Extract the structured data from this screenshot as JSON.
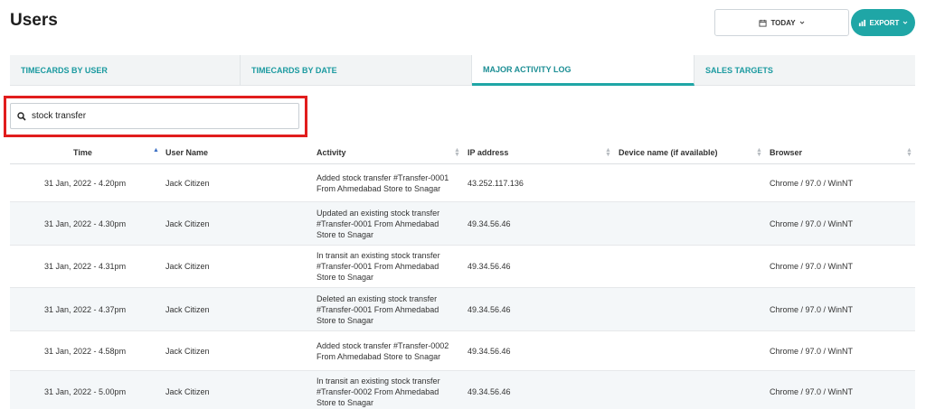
{
  "page": {
    "title": "Users"
  },
  "toolbar": {
    "today_label": "TODAY",
    "export_label": "EXPORT",
    "calendar_icon": "calendar-icon",
    "chart_icon": "bar-chart-icon"
  },
  "tabs": [
    {
      "label": "TIMECARDS BY USER",
      "active": false
    },
    {
      "label": "TIMECARDS BY DATE",
      "active": false
    },
    {
      "label": "MAJOR ACTIVITY LOG",
      "active": true
    },
    {
      "label": "SALES TARGETS",
      "active": false
    }
  ],
  "search": {
    "value": "stock transfer",
    "placeholder": ""
  },
  "table": {
    "columns": [
      "Time",
      "User Name",
      "Activity",
      "IP address",
      "Device name (if available)",
      "Browser"
    ],
    "rows": [
      {
        "time": "31 Jan, 2022 - 4.20pm",
        "user": "Jack Citizen",
        "activity": [
          "Added stock transfer #Transfer-0001",
          "From Ahmedabad Store to Snagar"
        ],
        "ip": "43.252.117.136",
        "device": "",
        "browser": "Chrome / 97.0 / WinNT"
      },
      {
        "time": "31 Jan, 2022 - 4.30pm",
        "user": "Jack Citizen",
        "activity": [
          "Updated an existing stock transfer",
          "#Transfer-0001 From Ahmedabad",
          "Store to Snagar"
        ],
        "ip": "49.34.56.46",
        "device": "",
        "browser": "Chrome / 97.0 / WinNT"
      },
      {
        "time": "31 Jan, 2022 - 4.31pm",
        "user": "Jack Citizen",
        "activity": [
          "In transit an existing stock transfer",
          "#Transfer-0001 From Ahmedabad",
          "Store to Snagar"
        ],
        "ip": "49.34.56.46",
        "device": "",
        "browser": "Chrome / 97.0 / WinNT"
      },
      {
        "time": "31 Jan, 2022 - 4.37pm",
        "user": "Jack Citizen",
        "activity": [
          "Deleted an existing stock transfer",
          "#Transfer-0001 From Ahmedabad",
          "Store to Snagar"
        ],
        "ip": "49.34.56.46",
        "device": "",
        "browser": "Chrome / 97.0 / WinNT"
      },
      {
        "time": "31 Jan, 2022 - 4.58pm",
        "user": "Jack Citizen",
        "activity": [
          "Added stock transfer #Transfer-0002",
          "From Ahmedabad Store to Snagar"
        ],
        "ip": "49.34.56.46",
        "device": "",
        "browser": "Chrome / 97.0 / WinNT"
      },
      {
        "time": "31 Jan, 2022 - 5.00pm",
        "user": "Jack Citizen",
        "activity": [
          "In transit an existing stock transfer",
          "#Transfer-0002 From Ahmedabad",
          "Store to Snagar"
        ],
        "ip": "49.34.56.46",
        "device": "",
        "browser": "Chrome / 97.0 / WinNT"
      }
    ]
  },
  "colors": {
    "accent": "#1fa6a6",
    "highlight": "#e11d1d",
    "sort_active": "#3b6fc4"
  }
}
